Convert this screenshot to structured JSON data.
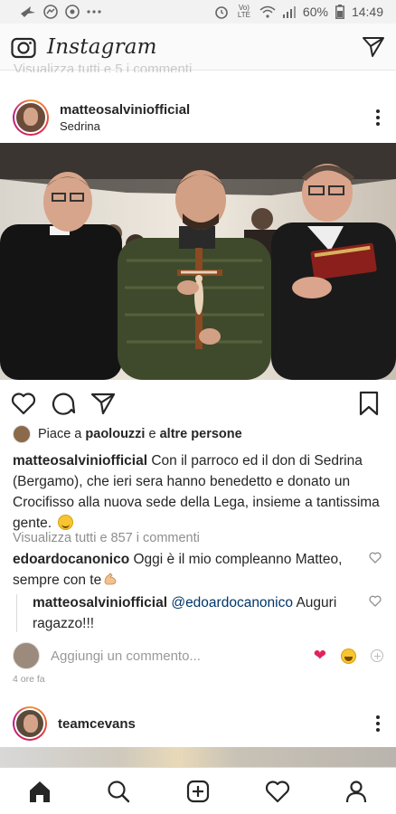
{
  "status_bar": {
    "battery": "60%",
    "time": "14:49",
    "network": "Vo) LTE"
  },
  "app_bar": {
    "title": "Instagram"
  },
  "ghost_text": "Visualizza tutti e 5 i commenti",
  "post": {
    "username": "matteosalviniofficial",
    "location": "Sedrina",
    "likes": {
      "prefix": "Piace a",
      "user": "paolouzzi",
      "connector": "e",
      "others": "altre persone"
    },
    "caption": {
      "author": "matteosalviniofficial",
      "text": "Con il parroco ed il don di Sedrina (Bergamo), che ieri sera hanno benedetto e donato un Crocifisso alla nuova sede della Lega, insieme a tantissima gente."
    },
    "view_all_comments": "Visualizza tutti e 857 i commenti",
    "comments": [
      {
        "author": "edoardocanonico",
        "text": "Oggi è il mio compleanno Matteo, sempre con te"
      },
      {
        "author": "matteosalviniofficial",
        "mention": "@edoardocanonico",
        "text": "Auguri ragazzo!!!"
      }
    ],
    "add_comment_placeholder": "Aggiungi un commento...",
    "timestamp": "4 ore fa"
  },
  "next_post": {
    "username": "teamcevans"
  },
  "icons": {
    "camera": "camera-icon",
    "direct": "paper-plane-icon",
    "like": "heart-icon",
    "comment": "comment-icon",
    "share": "paper-plane-icon",
    "save": "bookmark-icon",
    "home": "home-icon",
    "search": "search-icon",
    "new_post": "plus-square-icon",
    "activity": "heart-icon",
    "profile": "person-icon"
  },
  "colors": {
    "text": "#262626",
    "muted": "#8e8e8e",
    "mention": "#003569",
    "heart_emoji": "#e0245e"
  }
}
